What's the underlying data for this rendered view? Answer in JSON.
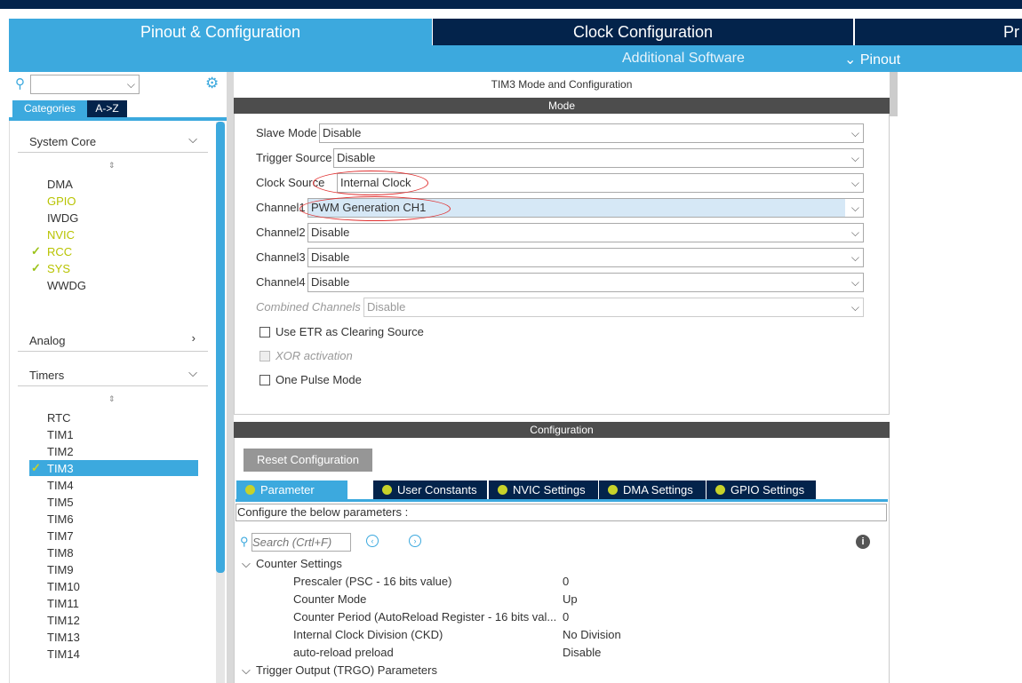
{
  "colors": {
    "navy": "#03234b",
    "light_blue": "#3ca9de",
    "bar_gray": "#4d4d4d",
    "ok_green": "#9cc31a",
    "highlight": "#b8c300"
  },
  "tabs": [
    "Pinout & Configuration",
    "Clock Configuration",
    "Pr"
  ],
  "subnav": {
    "additional": "Additional Software",
    "pinout": "⌄ Pinout"
  },
  "left": {
    "cat_tabs": [
      "Categories",
      "A->Z"
    ],
    "groups": [
      {
        "name": "System Core",
        "items": [
          "DMA",
          "GPIO",
          "IWDG",
          "NVIC",
          "RCC",
          "SYS",
          "WWDG"
        ]
      },
      {
        "name": "Analog"
      },
      {
        "name": "Timers",
        "items": [
          "RTC",
          "TIM1",
          "TIM2",
          "TIM3",
          "TIM4",
          "TIM5",
          "TIM6",
          "TIM7",
          "TIM8",
          "TIM9",
          "TIM10",
          "TIM11",
          "TIM12",
          "TIM13",
          "TIM14"
        ]
      }
    ]
  },
  "main": {
    "title": "TIM3 Mode and Configuration",
    "mode_header": "Mode",
    "fields": [
      {
        "label": "Slave Mode",
        "value": "Disable"
      },
      {
        "label": "Trigger Source",
        "value": "Disable"
      },
      {
        "label": "Clock Source",
        "value": "Internal Clock"
      },
      {
        "label": "Channel1",
        "value": "PWM Generation CH1"
      },
      {
        "label": "Channel2",
        "value": "Disable"
      },
      {
        "label": "Channel3",
        "value": "Disable"
      },
      {
        "label": "Channel4",
        "value": "Disable"
      },
      {
        "label": "Combined Channels",
        "value": "Disable"
      }
    ],
    "checkboxes": [
      "Use ETR as Clearing Source",
      "XOR activation",
      "One Pulse Mode"
    ],
    "config_header": "Configuration",
    "reset": "Reset Configuration",
    "config_tabs": [
      "Parameter Settings",
      "User Constants",
      "NVIC Settings",
      "DMA Settings",
      "GPIO Settings"
    ],
    "configure_text": "Configure the below parameters :",
    "search_placeholder": "Search (Crtl+F)",
    "tree": {
      "group1": "Counter Settings",
      "params": [
        [
          "Prescaler (PSC - 16 bits value)",
          "0"
        ],
        [
          "Counter Mode",
          "Up"
        ],
        [
          "Counter Period (AutoReload Register - 16 bits val...",
          "0"
        ],
        [
          "Internal Clock Division (CKD)",
          "No Division"
        ],
        [
          "auto-reload preload",
          "Disable"
        ]
      ],
      "group2": "Trigger Output (TRGO) Parameters"
    }
  }
}
